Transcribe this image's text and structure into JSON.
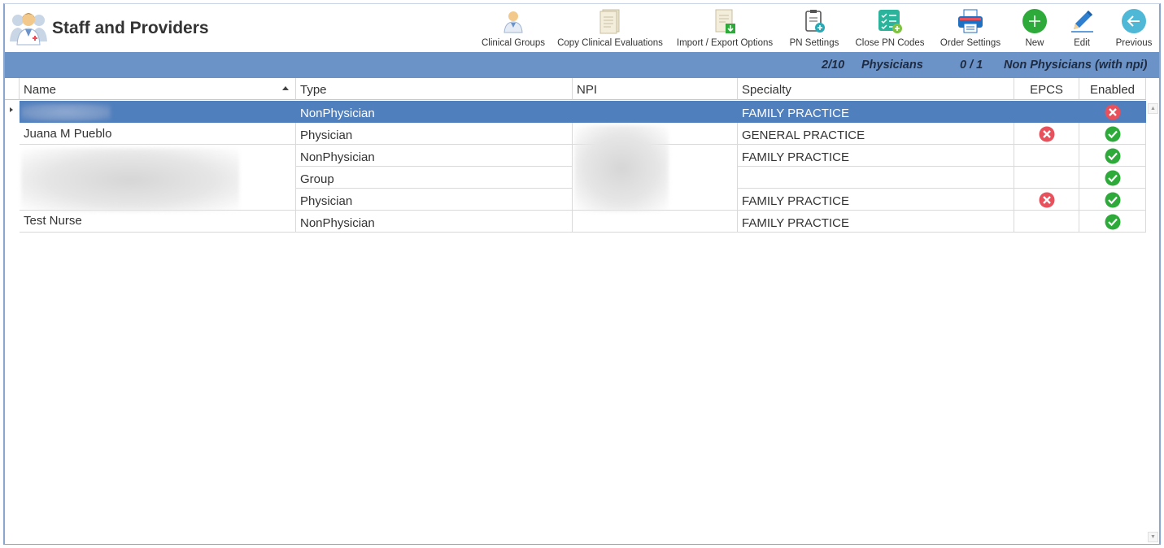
{
  "app": {
    "title": "Staff and Providers",
    "icon": "doctor-users-icon"
  },
  "toolbar": [
    {
      "label": "Clinical Groups",
      "icon": "doctor-group-icon"
    },
    {
      "label": "Copy Clinical Evaluations",
      "icon": "document-copy-icon"
    },
    {
      "label": "Import / Export Options",
      "icon": "document-import-icon"
    },
    {
      "label": "PN Settings",
      "icon": "clipboard-add-icon"
    },
    {
      "label": "Close PN Codes",
      "icon": "checklist-add-icon"
    },
    {
      "label": "Order Settings",
      "icon": "printer-icon"
    },
    {
      "label": "New",
      "icon": "plus-circle-icon"
    },
    {
      "label": "Edit",
      "icon": "pencil-icon"
    },
    {
      "label": "Previous",
      "icon": "arrow-left-circle-icon"
    }
  ],
  "status": {
    "physicians_count": "2/10",
    "physicians_label": "Physicians",
    "nonphys_count": "0 / 1",
    "nonphys_label": "Non Physicians (with npi)"
  },
  "grid": {
    "columns": [
      "Name",
      "Type",
      "NPI",
      "Specialty",
      "EPCS",
      "Enabled"
    ],
    "rows": [
      {
        "name": "",
        "type": "NonPhysician",
        "npi": "",
        "specialty": "FAMILY PRACTICE",
        "epcs": "",
        "enabled": "no",
        "selected": true
      },
      {
        "name": "Juana M Pueblo",
        "type": "Physician",
        "npi": "",
        "specialty": "GENERAL PRACTICE",
        "epcs": "no",
        "enabled": "yes"
      },
      {
        "name": "",
        "type": "NonPhysician",
        "npi": "",
        "specialty": "FAMILY PRACTICE",
        "epcs": "",
        "enabled": "yes"
      },
      {
        "name": "",
        "type": "Group",
        "npi": "",
        "specialty": "",
        "epcs": "",
        "enabled": "yes"
      },
      {
        "name": "",
        "type": "Physician",
        "npi": "",
        "specialty": "FAMILY PRACTICE",
        "epcs": "no",
        "enabled": "yes"
      },
      {
        "name": "Test Nurse",
        "type": "NonPhysician",
        "npi": "",
        "specialty": "FAMILY PRACTICE",
        "epcs": "",
        "enabled": "yes"
      }
    ]
  },
  "colors": {
    "status_bar": "#6b93c8",
    "selection": "#4f7fbd",
    "yes": "#2eaa3a",
    "no": "#e8505b"
  }
}
